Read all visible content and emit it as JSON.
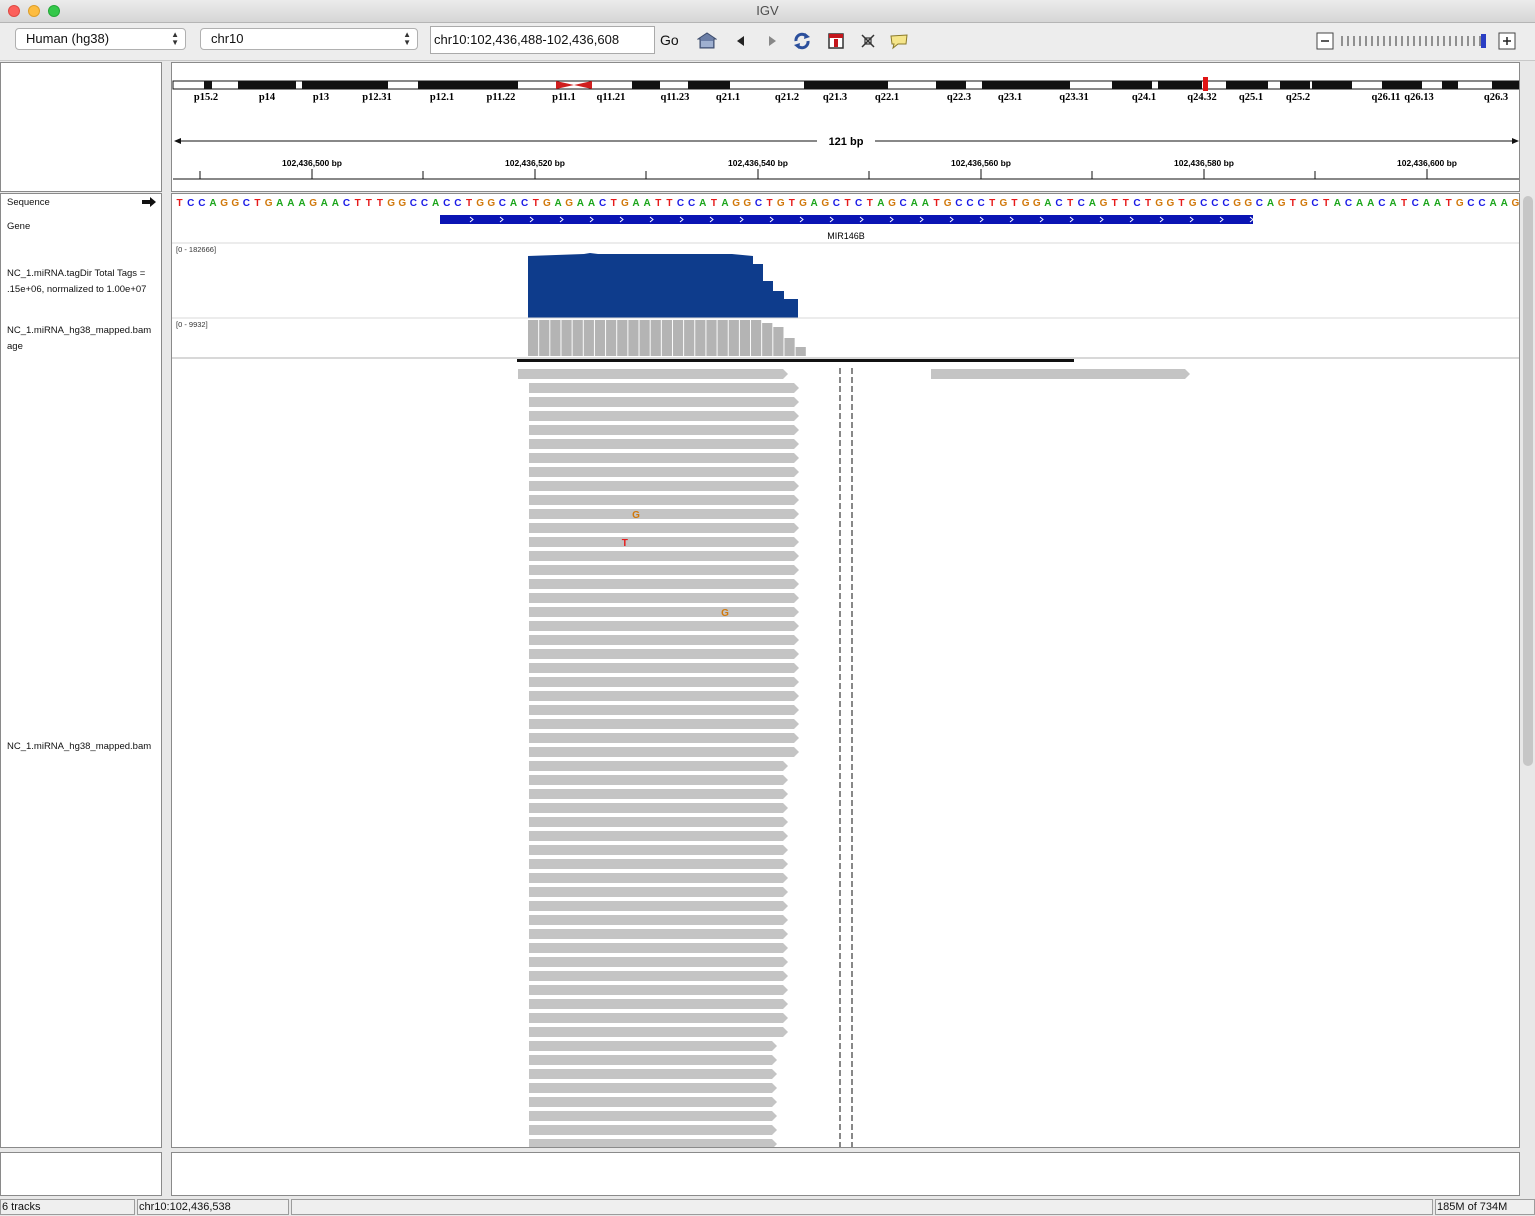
{
  "window": {
    "title": "IGV"
  },
  "toolbar": {
    "genome": "Human (hg38)",
    "chromosome": "chr10",
    "locus": "chr10:102,436,488-102,436,608",
    "go_label": "Go"
  },
  "ideogram": {
    "bands": [
      "p15.2",
      "p14",
      "p13",
      "p12.31",
      "p12.1",
      "p11.22",
      "p11.1",
      "q11.21",
      "q11.23",
      "q21.1",
      "q21.2",
      "q21.3",
      "q22.1",
      "q22.3",
      "q23.1",
      "q23.31",
      "q24.1",
      "q24.32",
      "q25.1",
      "q25.2",
      "q26.11",
      "q26.13",
      "q26.3"
    ]
  },
  "ruler": {
    "span_label": "121 bp",
    "ticks": [
      "102,436,500 bp",
      "102,436,520 bp",
      "102,436,540 bp",
      "102,436,560 bp",
      "102,436,580 bp",
      "102,436,600 bp"
    ]
  },
  "tracks": {
    "sequence_name": "Sequence",
    "gene_name": "Gene",
    "tagdir_name_line1": "NC_1.miRNA.tagDir Total Tags =",
    "tagdir_name_line2": ".15e+06, normalized to 1.00e+07",
    "coverage_name_line1": "NC_1.miRNA_hg38_mapped.bam",
    "coverage_name_line2": "age",
    "alignment_name": "NC_1.miRNA_hg38_mapped.bam",
    "tagdir_range": "[0 - 182666]",
    "coverage_range": "[0 - 9932]",
    "gene_label": "MIR146B",
    "sequence": "TCCAGGCTGAAAGAACTTTGGCCACCTGGCACTGAGAACTGAATTCCATAGGCTGTGAGCTCTAGCAATGCCCTGTGGACTCAGTTCTGGTGCCCGGCAGTGCTACAACATCAATGCCAAG",
    "mismatches": [
      {
        "row": 10,
        "base": "G",
        "pos": 41
      },
      {
        "row": 12,
        "base": "T",
        "pos": 40
      },
      {
        "row": 17,
        "base": "G",
        "pos": 49
      }
    ]
  },
  "colors": {
    "A": "#1aa51a",
    "C": "#1a1ae6",
    "G": "#d1780a",
    "T": "#e61a1a",
    "tagdir": "#0e3c8c",
    "gene": "#0a14b4",
    "read": "#c4c4c4",
    "coverage": "#b4b4b4"
  },
  "status": {
    "tracks": "6 tracks",
    "position": "chr10:102,436,538",
    "memory": "185M of 734M"
  }
}
